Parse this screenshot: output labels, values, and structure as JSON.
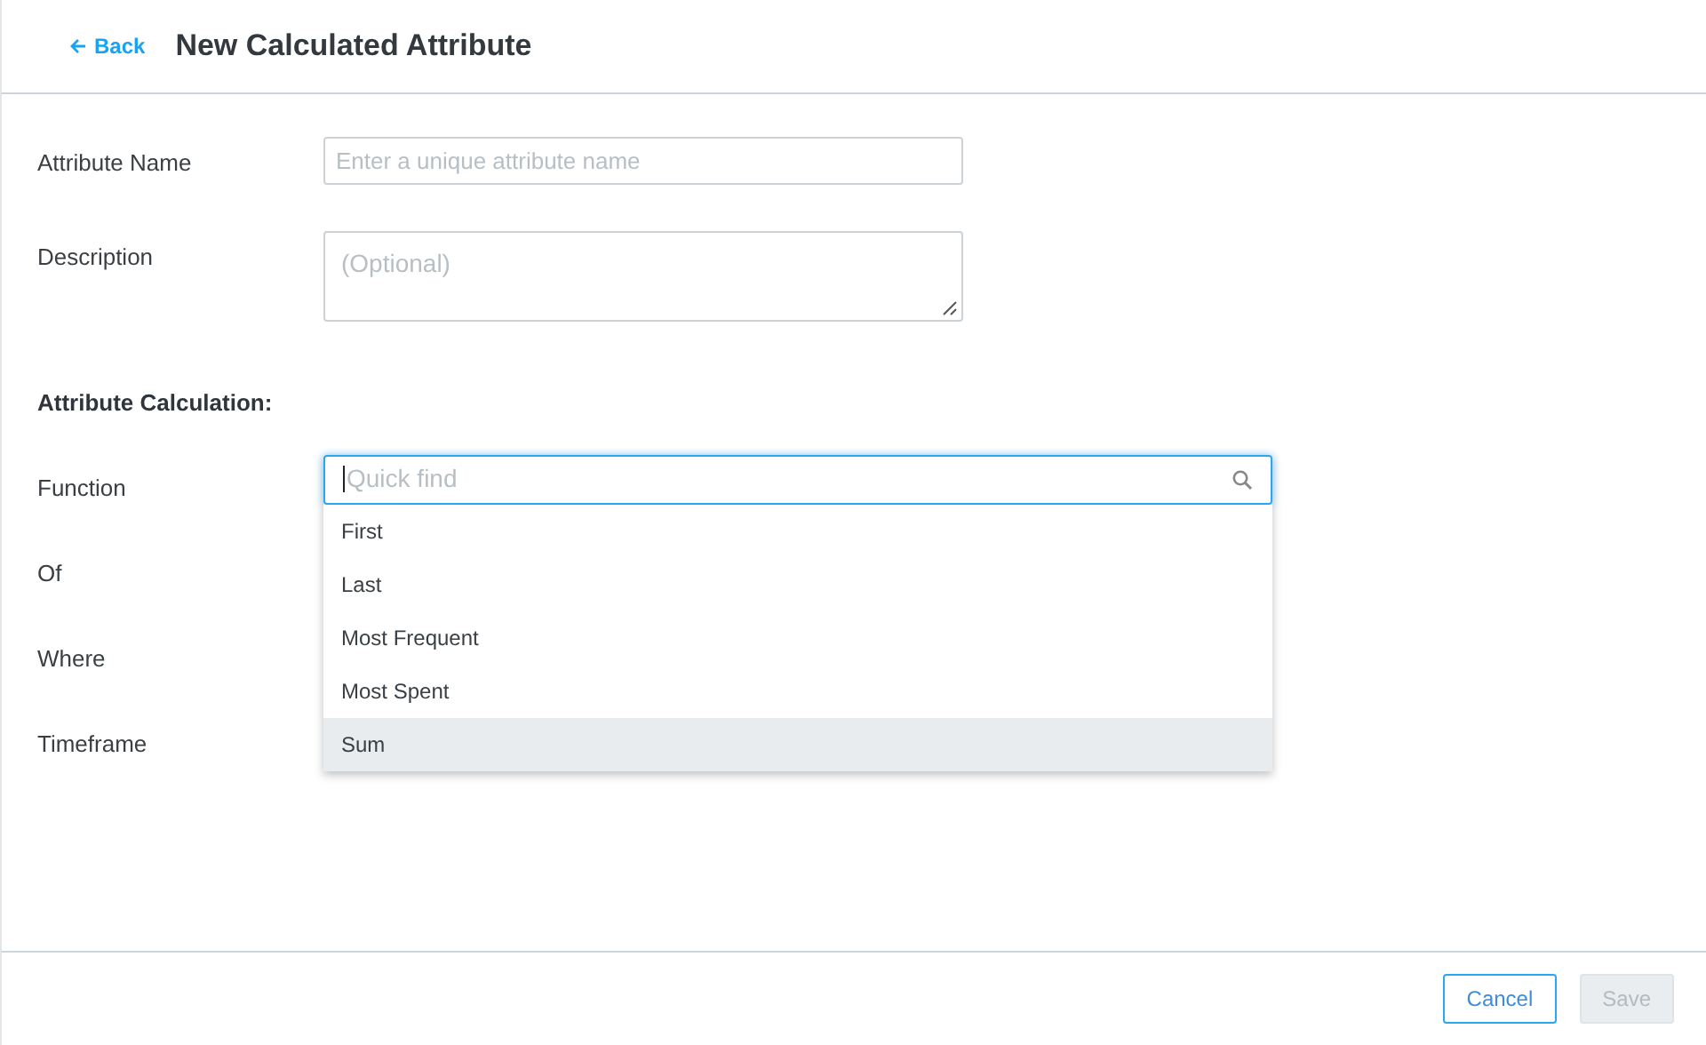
{
  "header": {
    "back_link": "Back",
    "title": "New Calculated Attribute"
  },
  "fields": [
    {
      "label": "Attribute Name",
      "kind": "input",
      "placeholder": "Enter a unique attribute name"
    },
    {
      "label": "Description",
      "kind": "textarea",
      "placeholder": "(Optional)"
    }
  ],
  "section_title": "Attribute Calculation:",
  "calculation_rows": [
    {
      "label": "Function"
    },
    {
      "label": "Of"
    },
    {
      "label": "Where"
    },
    {
      "label": "Timeframe"
    }
  ],
  "function_dropdown": {
    "placeholder": "Quick find",
    "options": [
      {
        "label": "First",
        "selected": false
      },
      {
        "label": "Last",
        "selected": false
      },
      {
        "label": "Most Frequent",
        "selected": false
      },
      {
        "label": "Most Spent",
        "selected": false
      },
      {
        "label": "Sum",
        "selected": true
      }
    ]
  },
  "footer": {
    "buttons": [
      {
        "label": "Cancel",
        "disabled": false
      },
      {
        "label": "Save",
        "disabled": true
      }
    ]
  }
}
